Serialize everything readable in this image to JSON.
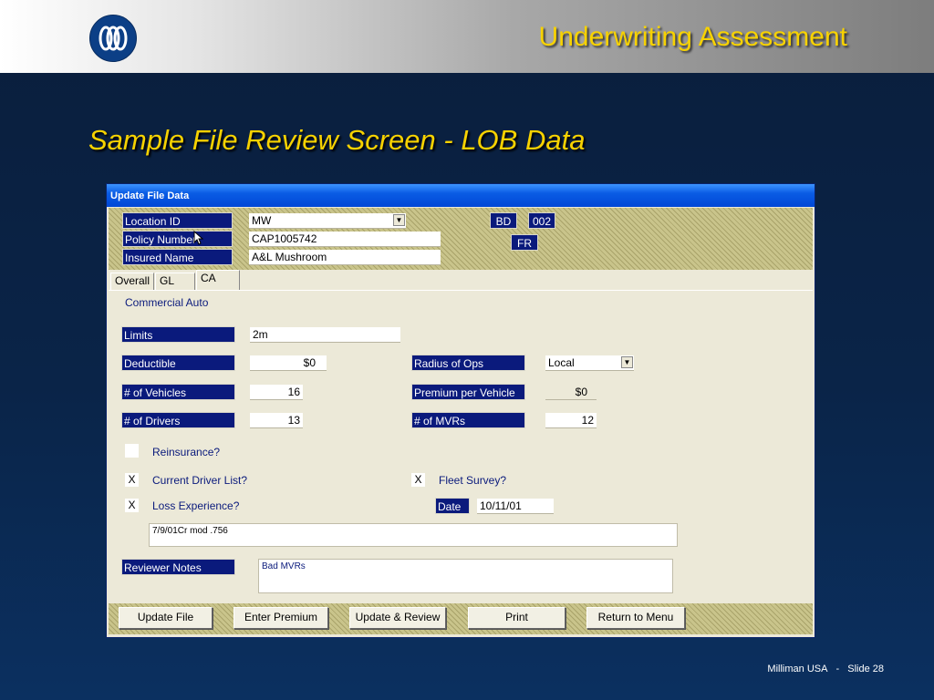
{
  "slide": {
    "title": "Underwriting Assessment",
    "subtitle": "Sample File Review Screen - LOB Data",
    "footer_company": "Milliman USA",
    "footer_sep": "-",
    "footer_slide": "Slide 28"
  },
  "window": {
    "title": "Update File Data",
    "header": {
      "location_label": "Location ID",
      "location_value": "MW",
      "policy_label": "Policy Number",
      "policy_value": "CAP1005742",
      "insured_label": "Insured Name",
      "insured_value": "A&L Mushroom",
      "bd_label": "BD",
      "bd_value": "002",
      "fr_label": "FR"
    },
    "tabs": [
      "Overall",
      "GL",
      "CA"
    ],
    "active_tab": "CA",
    "section_title": "Commercial Auto",
    "fields": {
      "limits_label": "Limits",
      "limits_value": "2m",
      "deductible_label": "Deductible",
      "deductible_value": "$0",
      "vehicles_label": "# of Vehicles",
      "vehicles_value": "16",
      "drivers_label": "# of Drivers",
      "drivers_value": "13",
      "radius_label": "Radius of Ops",
      "radius_value": "Local",
      "premium_label": "Premium per Vehicle",
      "premium_value": "$0",
      "mvrs_label": "# of MVRs",
      "mvrs_value": "12"
    },
    "checks": {
      "reinsurance_label": "Reinsurance?",
      "reinsurance_value": "",
      "driver_list_label": "Current Driver List?",
      "driver_list_value": "X",
      "loss_exp_label": "Loss Experience?",
      "loss_exp_value": "X",
      "fleet_label": "Fleet Survey?",
      "fleet_value": "X",
      "date_label": "Date",
      "date_value": "10/11/01"
    },
    "loss_notes": "7/9/01Cr mod .756",
    "reviewer_label": "Reviewer Notes",
    "reviewer_notes": "Bad MVRs",
    "buttons": {
      "update_file": "Update File",
      "enter_premium": "Enter Premium",
      "update_review": "Update & Review",
      "print": "Print",
      "return_menu": "Return to Menu"
    }
  },
  "colors": {
    "title_yellow": "#f7d200",
    "label_navy": "#0a1a7c",
    "window_bg": "#ece9d8",
    "titlebar_blue": "#0a5ce4"
  }
}
